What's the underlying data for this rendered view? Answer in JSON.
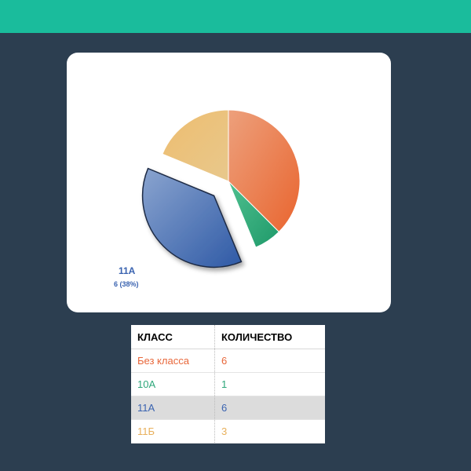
{
  "colors": {
    "header": "#1abc9c",
    "background": "#2c3e50"
  },
  "chart_data": {
    "type": "pie",
    "categories": [
      "Без класса",
      "10А",
      "11А",
      "11Б"
    ],
    "values": [
      6,
      1,
      6,
      3
    ],
    "colors": [
      "#e8673a",
      "#2ea77a",
      "#3a63b0",
      "#e8b05c"
    ],
    "exploded": "11А",
    "label": {
      "name": "11А",
      "value": "6 (38%)"
    }
  },
  "table": {
    "headers": [
      "КЛАСС",
      "КОЛИЧЕСТВО"
    ],
    "rows": [
      {
        "class": "Без класса",
        "count": "6",
        "color": "#e8673a"
      },
      {
        "class": "10А",
        "count": "1",
        "color": "#2ea77a"
      },
      {
        "class": "11А",
        "count": "6",
        "color": "#3a63b0"
      },
      {
        "class": "11Б",
        "count": "3",
        "color": "#e8b05c"
      }
    ],
    "highlighted_row": "11А"
  }
}
